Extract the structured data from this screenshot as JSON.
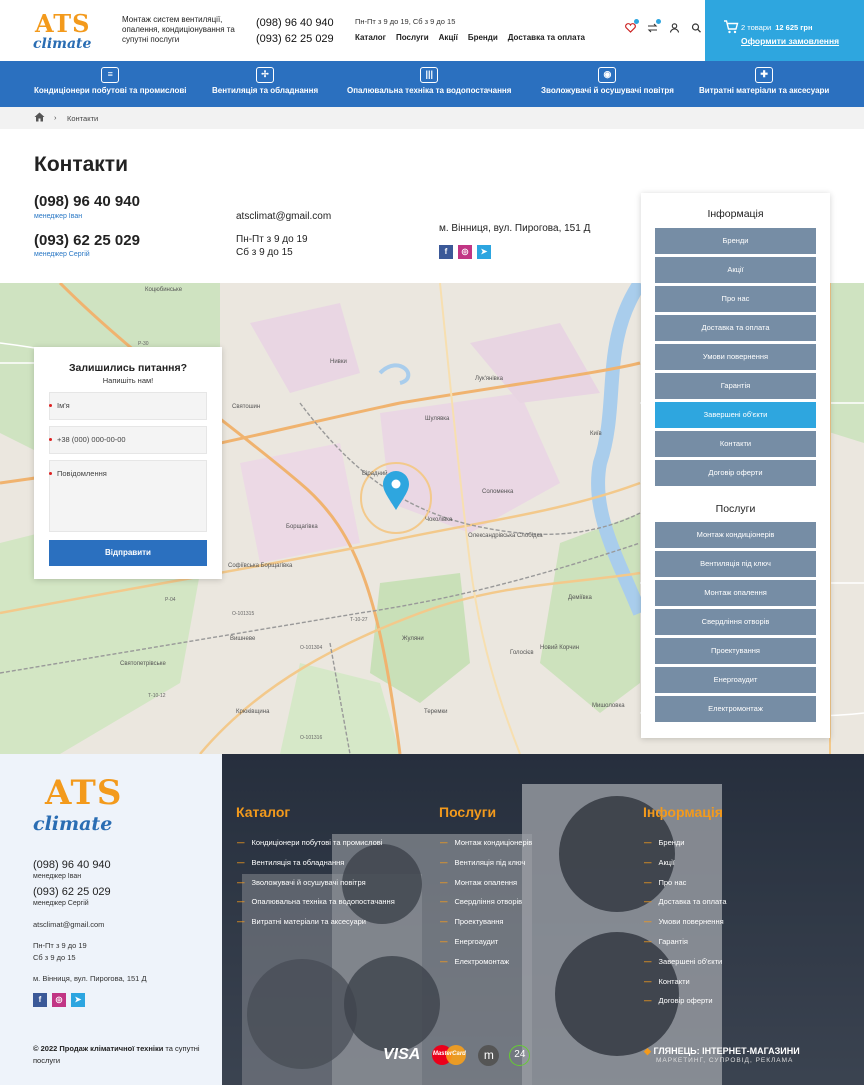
{
  "header": {
    "logo_top": "ATS",
    "logo_bottom": "climate",
    "tagline": "Монтаж систем вентиляції, опалення, кондиціонування та супутні послуги",
    "phone1": "(098) 96 40 940",
    "phone2": "(093) 62 25 029",
    "hours": "Пн-Пт з 9 до 19,  Сб з 9 до 15",
    "nav": [
      "Каталог",
      "Послуги",
      "Акції",
      "Бренди",
      "Доставка та оплата"
    ],
    "cart_count": "2 товари",
    "cart_sum": "12 625 грн",
    "cart_checkout": "Оформити замовлення",
    "icons": [
      "heart-icon",
      "compare-icon",
      "user-icon",
      "search-icon"
    ]
  },
  "categories": [
    "Кондиціонери побутові та промислові",
    "Вентиляція та обладнання",
    "Опалювальна техніка та водопостачання",
    "Зволожувачі й осушувачі повітря",
    "Витратні матеріали та аксесуари"
  ],
  "breadcrumb": {
    "separator": "›",
    "current": "Контакти"
  },
  "contacts": {
    "title": "Контакти",
    "phone1": "(098) 96 40 940",
    "manager1": "менеджер Іван",
    "phone2": "(093) 62 25 029",
    "manager2": "менеджер Сергій",
    "email": "atsclimat@gmail.com",
    "hours1": "Пн-Пт з 9 до 19",
    "hours2": "Сб з 9 до 15",
    "address": "м. Вінниця, вул. Пирогова, 151 Д",
    "socials": [
      {
        "name": "facebook-icon",
        "glyph": "f",
        "color": "#3b5998"
      },
      {
        "name": "instagram-icon",
        "glyph": "◎",
        "color": "#c13584"
      },
      {
        "name": "telegram-icon",
        "glyph": "➤",
        "color": "#2ca5e0"
      }
    ]
  },
  "map": {
    "labels": [
      "Коцюбинське",
      "Нивки",
      "Лук'янівка",
      "Святошин",
      "Шулявка",
      "Київ",
      "Вірадний",
      "Соломенка",
      "Борщагівка",
      "Чоколівка",
      "Олександрівська Слобідка",
      "Вишневе",
      "Жуляни",
      "Голосієв",
      "Деміївка",
      "Мишоловка",
      "Теремки",
      "Святопетрівське",
      "Крюківщина",
      "Софіївська Борщагівка",
      "Новий Корчин"
    ],
    "roads": [
      "О-101315",
      "О-101304",
      "О-101316",
      "Т-10-27",
      "Т-10-12",
      "Р-04",
      "Р-30"
    ],
    "accent": "#2ea6df"
  },
  "question_form": {
    "title": "Залишились питання?",
    "subtitle": "Напишіть нам!",
    "name_placeholder": "Ім'я",
    "phone_placeholder": "+38 (000) 000-00-00",
    "message_placeholder": "Повідомлення",
    "submit": "Відправити"
  },
  "sidebar": {
    "info_title": "Інформація",
    "info_items": [
      "Бренди",
      "Акції",
      "Про нас",
      "Доставка та оплата",
      "Умови повернення",
      "Гарантія",
      "Завершені об'єкти",
      "Контакти",
      "Договір оферти"
    ],
    "active_item": "Завершені об'єкти",
    "services_title": "Послуги",
    "services_items": [
      "Монтаж кондиціонерів",
      "Вентиляція під ключ",
      "Монтаж опалення",
      "Свердління отворів",
      "Проектування",
      "Енергоаудит",
      "Електромонтаж"
    ]
  },
  "footer": {
    "logo_top": "ATS",
    "logo_bottom": "climate",
    "phone1": "(098) 96 40 940",
    "manager1": "менеджер Іван",
    "phone2": "(093) 62 25 029",
    "manager2": "менеджер Сергій",
    "email": "atsclimat@gmail.com",
    "hours1": "Пн-Пт з 9 до 19",
    "hours2": "Сб з 9 до 15",
    "address": "м. Вінниця, вул. Пирогова, 151 Д",
    "catalog_title": "Каталог",
    "catalog": [
      "Кондиціонери побутові та промислові",
      "Вентиляція та обладнання",
      "Зволожувачі й осушувачі повітря",
      "Опалювальна техніка та водопостачання",
      "Витратні матеріали та аксесуари"
    ],
    "services_title": "Послуги",
    "services": [
      "Монтаж кондиціонерів",
      "Вентиляція під ключ",
      "Монтаж опалення",
      "Свердління отворів",
      "Проектування",
      "Енергоаудит",
      "Електромонтаж"
    ],
    "info_title": "Інформація",
    "info": [
      "Бренди",
      "Акції",
      "Про нас",
      "Доставка та оплата",
      "Умови повернення",
      "Гарантія",
      "Завершені об'єкти",
      "Контакти",
      "Договір оферти"
    ],
    "copyright_bold": "© 2022 Продаж кліматичної техніки",
    "copyright_rest": " та супутні послуги",
    "payments": [
      "VISA",
      "MasterCard",
      "m",
      "24"
    ],
    "dev_title": "ГЛЯНЕЦЬ: ІНТЕРНЕТ-МАГАЗИНИ",
    "dev_sub": "МАРКЕТИНГ, СУПРОВІД, РЕКЛАМА",
    "brand_orange": "#f39a1c",
    "brand_blue": "#2b70bf"
  }
}
